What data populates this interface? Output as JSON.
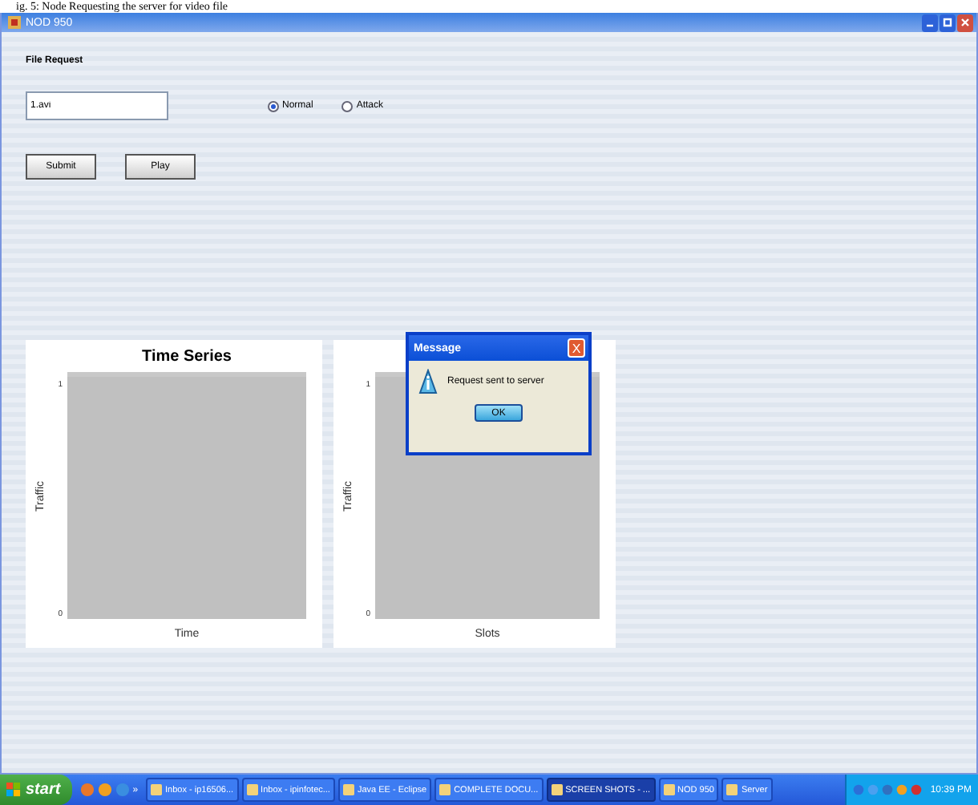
{
  "caption": "ig. 5: Node Requesting the server for video file",
  "window": {
    "title": "NOD 950"
  },
  "form": {
    "label": "File Request",
    "file_value": "1.avi",
    "modes": [
      {
        "label": "Normal",
        "selected": true
      },
      {
        "label": "Attack",
        "selected": false
      }
    ],
    "buttons": [
      "Submit",
      "Play"
    ]
  },
  "charts": [
    {
      "title": "Time Series",
      "x_label": "Time",
      "y_label": "Traffic",
      "y_ticks": [
        "1",
        "0"
      ]
    },
    {
      "x_label": "Slots",
      "y_label": "Traffic",
      "y_ticks": [
        "1",
        "0"
      ]
    }
  ],
  "dialog": {
    "title": "Message",
    "close": "X",
    "message": "Request sent to server",
    "button": "OK"
  },
  "taskbar": {
    "start": "start",
    "more": "»",
    "tasks": [
      {
        "label": "Inbox - ip16506...",
        "selected": false
      },
      {
        "label": "Inbox - ipinfotec...",
        "selected": false
      },
      {
        "label": "Java EE - Eclipse",
        "selected": false
      },
      {
        "label": "COMPLETE DOCU...",
        "selected": false
      },
      {
        "label": "SCREEN SHOTS - ...",
        "selected": true
      },
      {
        "label": "NOD 950",
        "selected": false
      },
      {
        "label": "Server",
        "selected": false
      }
    ],
    "clock": "10:39 PM"
  }
}
